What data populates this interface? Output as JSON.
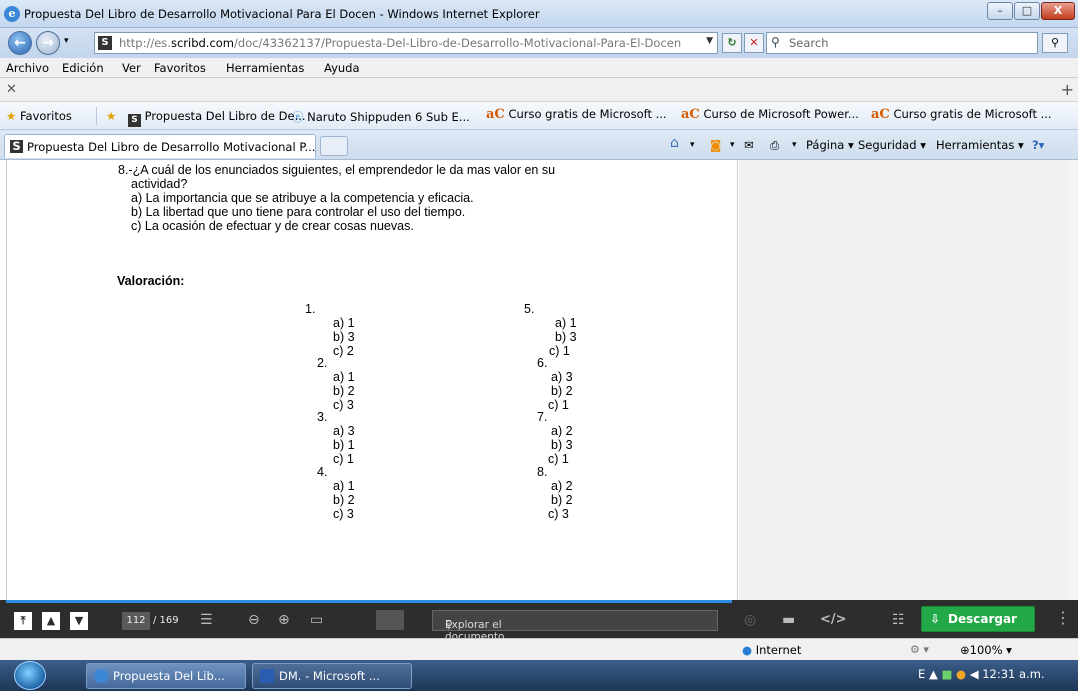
{
  "window": {
    "title": "Propuesta Del Libro de Desarrollo Motivacional Para El Docen - Windows Internet Explorer",
    "controls": {
      "minimize": "–",
      "maximize": "□",
      "close": "X"
    }
  },
  "address": {
    "url_prefix": "http://es.",
    "url_domain": "scribd.com",
    "url_path": "/doc/43362137/Propuesta-Del-Libro-de-Desarrollo-Motivacional-Para-El-Docen",
    "search_placeholder": "Search"
  },
  "menu": [
    "Archivo",
    "Edición",
    "Ver",
    "Favoritos",
    "Herramientas",
    "Ayuda"
  ],
  "favorites": {
    "label": "Favoritos",
    "items": [
      "Propuesta Del Libro de De...",
      "Naruto Shippuden 6 Sub E...",
      "Curso gratis de Microsoft ...",
      "Curso de Microsoft Power...",
      "Curso gratis de Microsoft ..."
    ]
  },
  "tab": {
    "title": "Propuesta Del Libro de Desarrollo Motivacional P..."
  },
  "toolbar": {
    "pagina": "Página ▾",
    "seguridad": "Seguridad ▾",
    "herramientas": "Herramientas ▾"
  },
  "document": {
    "question": {
      "line1": "8.-¿A cuál de los enunciados siguientes, el emprendedor le da mas valor en su",
      "line2": "actividad?",
      "options": [
        "a)  La importancia que se atribuye a la competencia y eficacia.",
        "b)  La libertad que uno tiene para controlar el uso del tiempo.",
        "c)  La ocasión de efectuar y de crear cosas nuevas."
      ]
    },
    "valoracion_title": "Valoración:",
    "left_column": [
      {
        "num": "1.",
        "a": "a)  1",
        "b": "b)  3",
        "c": "c)  2"
      },
      {
        "num": "2.",
        "a": "a)  1",
        "b": "b)  2",
        "c": "c)  3"
      },
      {
        "num": "3.",
        "a": "a)  3",
        "b": "b)  1",
        "c": "c)  1"
      },
      {
        "num": "4.",
        "a": "a)  1",
        "b": "b)  2",
        "c": "c)  3"
      }
    ],
    "right_column": [
      {
        "num": "5.",
        "a": "a)  1",
        "b": "b)  3",
        "c": "c)  1"
      },
      {
        "num": "6.",
        "a": "a)  3",
        "b": "b)  2",
        "c": "c)  1"
      },
      {
        "num": "7.",
        "a": "a)  2",
        "b": "b)  3",
        "c": "c)  1"
      },
      {
        "num": "8.",
        "a": "a)  2",
        "b": "b)  2",
        "c": "c)  3"
      }
    ]
  },
  "viewer": {
    "current_page": "112",
    "total_pages": "/ 169",
    "search_placeholder": "Explorar el documento...",
    "download_label": "Descargar",
    "embed_icon": "</>"
  },
  "status": {
    "zone": "Internet",
    "zoom": "100%"
  },
  "taskbar": {
    "buttons": [
      "Propuesta Del Lib...",
      "DM. - Microsoft ..."
    ],
    "clock": "12:31 a.m.",
    "lang": "E"
  }
}
